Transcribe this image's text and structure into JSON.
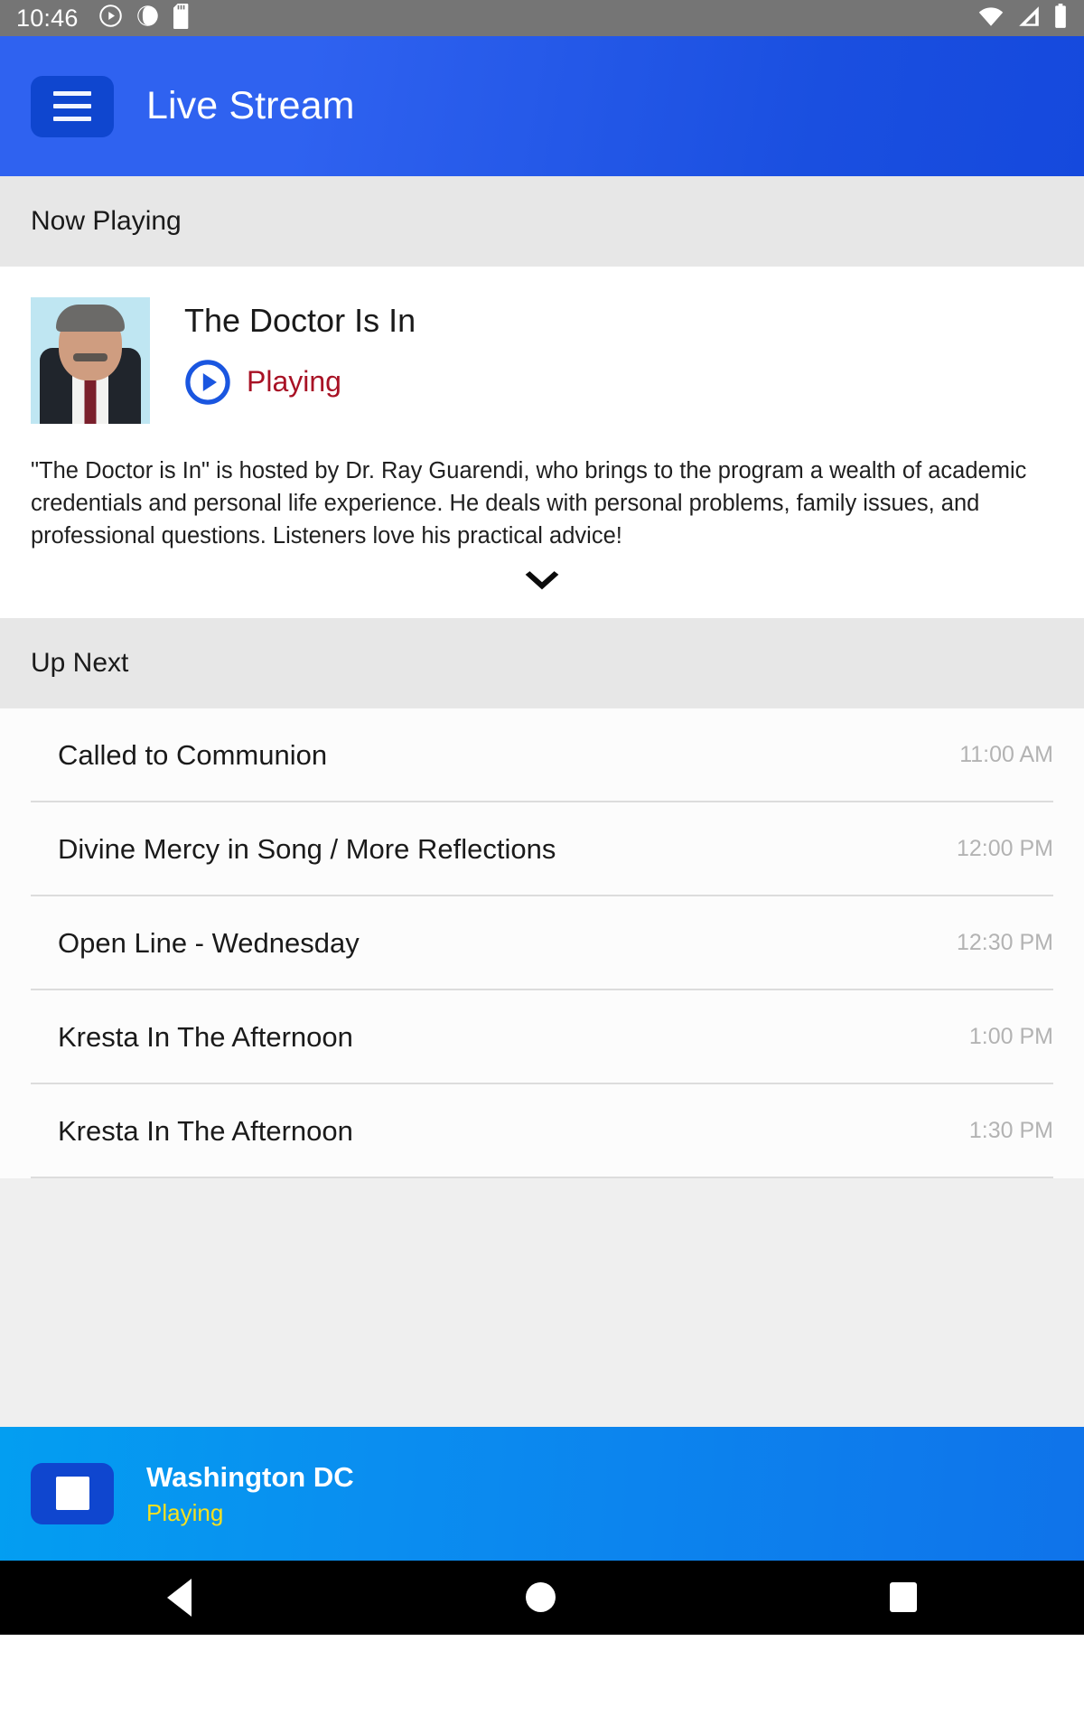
{
  "statusbar": {
    "clock": "10:46",
    "left_icons": [
      "play-circle-icon",
      "cast-icon",
      "sd-card-icon"
    ],
    "right_icons": [
      "wifi-icon",
      "cellular-signal-icon",
      "battery-icon"
    ]
  },
  "appbar": {
    "menu_icon": "hamburger-menu-icon",
    "title": "Live Stream",
    "background_color": "#2f62f0",
    "button_color": "#0f46cf"
  },
  "now_playing": {
    "section_label": "Now Playing",
    "thumbnail_alt": "host-portrait",
    "title": "The Doctor Is In",
    "status": "Playing",
    "status_color": "#a81225",
    "play_icon": "play-circle-icon",
    "play_icon_color": "#1a56e0",
    "description": "\"The Doctor is In\" is hosted by Dr. Ray Guarendi, who brings to the program a wealth of academic credentials and personal life experience. He deals with personal problems, family issues, and professional questions. Listeners love his practical advice!",
    "expand_icon": "chevron-down-icon"
  },
  "up_next": {
    "section_label": "Up Next",
    "items": [
      {
        "title": "Called to Communion",
        "time": "11:00 AM"
      },
      {
        "title": "Divine Mercy in Song / More Reflections",
        "time": "12:00 PM"
      },
      {
        "title": "Open Line - Wednesday",
        "time": "12:30 PM"
      },
      {
        "title": "Kresta In The Afternoon",
        "time": "1:00 PM"
      },
      {
        "title": "Kresta In The Afternoon",
        "time": "1:30 PM"
      }
    ]
  },
  "player": {
    "stop_icon": "stop-square-icon",
    "title": "Washington DC",
    "status": "Playing",
    "status_color": "#f5e020",
    "background_color": "#039ef1"
  },
  "navbar": {
    "back": "back-triangle-icon",
    "home": "home-circle-icon",
    "recents": "recents-square-icon"
  }
}
